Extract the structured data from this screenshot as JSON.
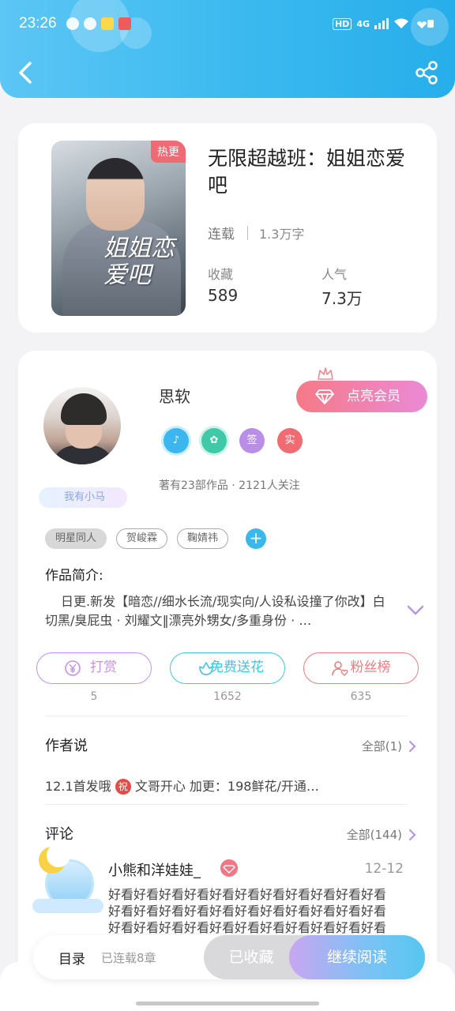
{
  "status_bar": {
    "time": "23:26",
    "network": "4G",
    "hd": "HD"
  },
  "book": {
    "cover_badge": "热更",
    "cover_art_text": "姐姐恋爱吧",
    "title": "无限超越班：姐姐恋爱吧",
    "status": "连载",
    "word_count": "1.3万字",
    "favorites_label": "收藏",
    "favorites_value": "589",
    "popularity_label": "人气",
    "popularity_value": "7.3万"
  },
  "author": {
    "name": "思软",
    "vip_button": "点亮会员",
    "badges": [
      {
        "icon": "music-badge-icon",
        "color": "#3bb6ee"
      },
      {
        "icon": "handshake-badge-icon",
        "color": "#3fc9a8"
      },
      {
        "label": "签",
        "color": "#b98ee6"
      },
      {
        "label": "实",
        "color": "#f06b72"
      }
    ],
    "works_line": "著有23部作品 · 2121人关注",
    "fan_tag": "我有小马"
  },
  "tags": [
    "明星同人",
    "贺峻霖",
    "鞠婧祎"
  ],
  "intro": {
    "heading": "作品简介:",
    "text": "日更.新发【暗恋//细水长流/现实向/人设私设撞了你改】白切黑/臭屁虫 · 刘耀文‖漂亮外甥女/多重身份 · …"
  },
  "actions": [
    {
      "label": "打赏",
      "count": "5",
      "color": "#c592e8"
    },
    {
      "label": "免费送花",
      "count": "1652",
      "color": "#3fc6e0"
    },
    {
      "label": "粉丝榜",
      "count": "635",
      "color": "#ec7d80"
    }
  ],
  "author_says": {
    "heading": "作者说",
    "more": "全部(1)",
    "text_before": "12.1首发哦",
    "zhu": "祝",
    "text_after": "文哥开心 加更：198鲜花/开通…"
  },
  "comments": {
    "heading": "评论",
    "more": "全部(144)",
    "items": [
      {
        "user": "小熊和洋娃娃_",
        "date": "12-12",
        "text": "好看好看好看好看好看好看好看好看好看好看好看好看好看好看好看好看好看好看好看好看好看好看好看好看好看好看好看好看好看好看好看好看好看好看好看好看好看好看好看好看"
      }
    ]
  },
  "bottom_bar": {
    "toc": "目录",
    "serial": "已连载8章",
    "collected": "已收藏",
    "continue": "继续阅读"
  },
  "colors": {
    "header_from": "#5cc6f5",
    "header_to": "#27aeea",
    "vip_from": "#f57a86",
    "vip_to": "#ea8ad6",
    "accent_blue": "#3ab8ec"
  }
}
